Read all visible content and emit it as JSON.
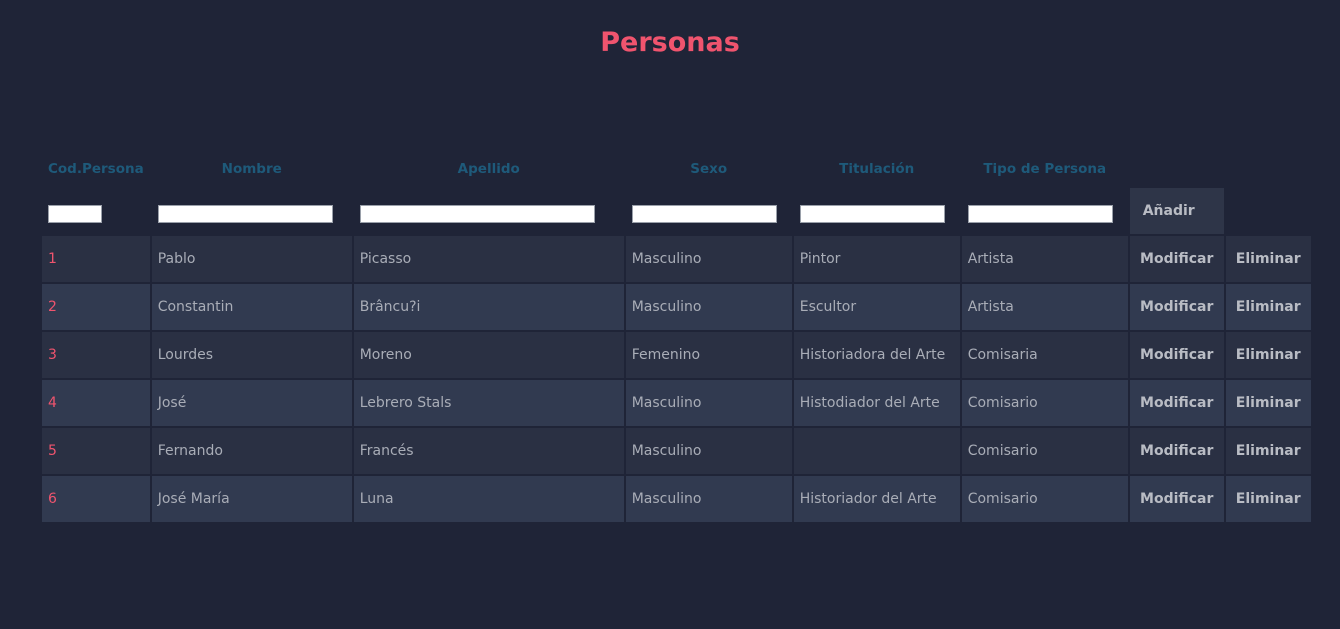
{
  "page": {
    "title": "Personas"
  },
  "table": {
    "headers": [
      "Cod.Persona",
      "Nombre",
      "Apellido",
      "Sexo",
      "Titulación",
      "Tipo de Persona"
    ],
    "add_label": "Añadir",
    "modify_label": "Modificar",
    "delete_label": "Eliminar",
    "inputs": {
      "cod": "",
      "nombre": "",
      "apellido": "",
      "sexo": "",
      "titulacion": "",
      "tipo": ""
    },
    "rows": [
      {
        "cod": "1",
        "nombre": "Pablo",
        "apellido": "Picasso",
        "sexo": "Masculino",
        "titulacion": "Pintor",
        "tipo": "Artista"
      },
      {
        "cod": "2",
        "nombre": "Constantin",
        "apellido": "Brâncu?i",
        "sexo": "Masculino",
        "titulacion": "Escultor",
        "tipo": "Artista"
      },
      {
        "cod": "3",
        "nombre": "Lourdes",
        "apellido": "Moreno",
        "sexo": "Femenino",
        "titulacion": "Historiadora del Arte",
        "tipo": "Comisaria"
      },
      {
        "cod": "4",
        "nombre": "José",
        "apellido": "Lebrero Stals",
        "sexo": "Masculino",
        "titulacion": "Histodiador del Arte",
        "tipo": "Comisario"
      },
      {
        "cod": "5",
        "nombre": "Fernando",
        "apellido": "Francés",
        "sexo": "Masculino",
        "titulacion": "",
        "tipo": "Comisario"
      },
      {
        "cod": "6",
        "nombre": "José María",
        "apellido": "Luna",
        "sexo": "Masculino",
        "titulacion": "Historiador del Arte",
        "tipo": "Comisario"
      }
    ]
  },
  "colors": {
    "background": "#1f2437",
    "title": "#f0546e",
    "header": "#1e5a7a",
    "row": "#2a3043",
    "row_alt": "#313a50",
    "text": "#a9adb7"
  }
}
